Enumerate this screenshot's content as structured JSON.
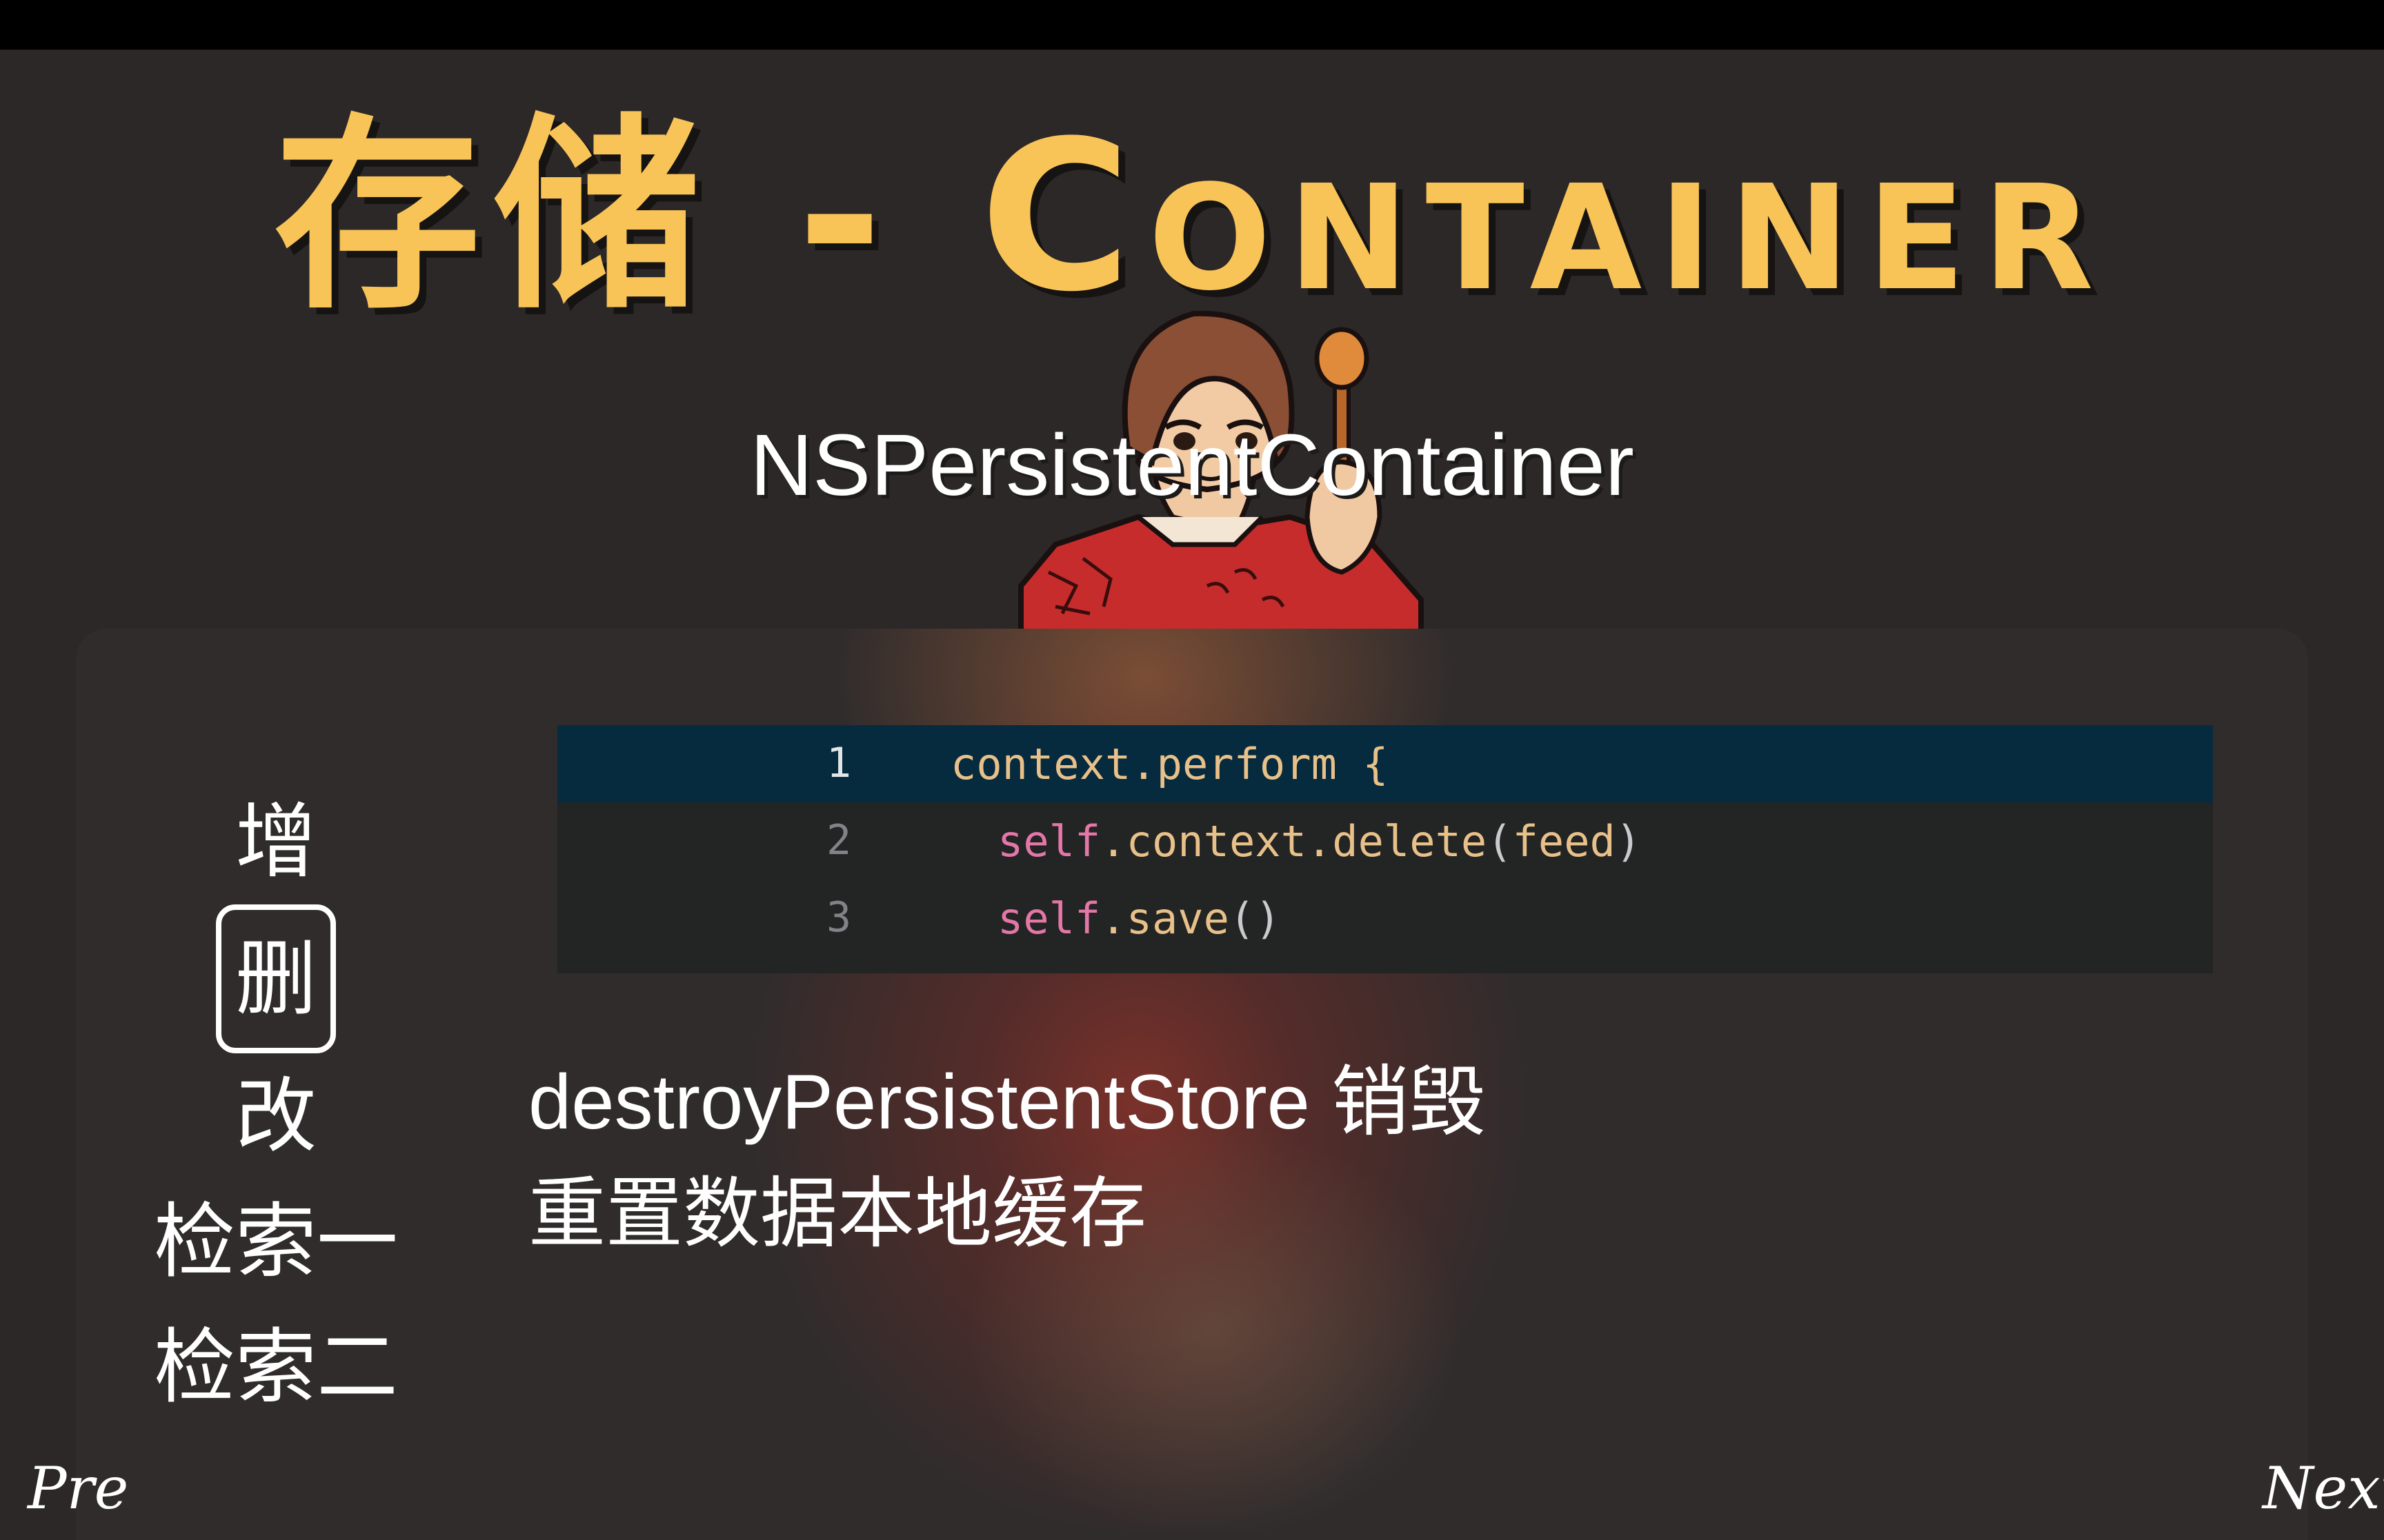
{
  "slide": {
    "title_cjk": "存储 - ",
    "title_latin": "Container",
    "subtitle": "NSPersistentContainer"
  },
  "code": {
    "lines": [
      {
        "number": "1",
        "parts": [
          {
            "t": "context.perform {",
            "c": "fn"
          }
        ]
      },
      {
        "number": "2",
        "parts": [
          {
            "t": "self",
            "c": "kw"
          },
          {
            "t": ".context.delete",
            "c": "fn"
          },
          {
            "t": "(",
            "c": "pn"
          },
          {
            "t": "feed",
            "c": "fn"
          },
          {
            "t": ")",
            "c": "pn"
          }
        ]
      },
      {
        "number": "3",
        "parts": [
          {
            "t": "self",
            "c": "kw"
          },
          {
            "t": ".save",
            "c": "fn"
          },
          {
            "t": "()",
            "c": "pn"
          }
        ]
      }
    ]
  },
  "menu": {
    "items": [
      "增",
      "删",
      "改",
      "检索一",
      "检索二"
    ],
    "selected_index": 1
  },
  "description": "destroyPersistentStore 销毁重置数据本地缓存",
  "nav": {
    "prev": "Pre",
    "next": "Next"
  },
  "colors": {
    "title": "#f9c457",
    "background": "#2c2828",
    "code_active_line": "#062a3e",
    "keyword": "#e377a8",
    "identifier": "#e8c089"
  }
}
